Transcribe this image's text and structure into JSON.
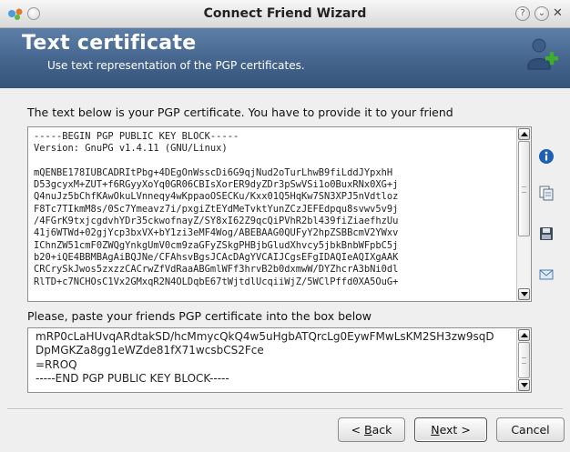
{
  "window": {
    "title": "Connect Friend Wizard"
  },
  "banner": {
    "title": "Text certificate",
    "subtitle": "Use text representation of the PGP certificates."
  },
  "main_label": "The text below is your PGP certificate. You have to provide it to your friend",
  "own_certificate": {
    "lines": [
      "-----BEGIN PGP PUBLIC KEY BLOCK-----",
      "Version: GnuPG v1.4.11 (GNU/Linux)",
      "",
      "mQENBE178IUBCADRItPbg+4DEgOnWsscDi6G9qjNud2oTurLhwB9fiLddJYpxhH",
      "D53gcyxM+ZUT+f6RGyyXoYq0GR06CBIsXorER9dyZDr3pSwVSi1o0BuxRNx0XG+j",
      "Q4nuJz5bChfKAwOkuLVnneqy4wKppaoOSECKu/Kxx01Q5HqKw7SN3XPJ5nVdtloz",
      "F8Tc7TIkmM8s/0Sc7Ymeavz7i/pxgiZtEYdMeTvktYunZCzJEFEdpqu8svwv5v9j",
      "/4FGrK9txjcgdvhYDr35ckwofnayZ/SY8xI62Z9qcQiPVhR2bl439fiZiaefhzUu",
      "41j6WTWd+02gjYcp3bxVX+bY1zi3eMF4Wog/ABEBAAG0QUFyY2hpZSBBcmV2YWxv",
      "IChnZW51cmF0ZWQgYnkgUmV0cm9zaGFyZSkgPHBjbGludXhvcy5jbkBnbWFpbC5j",
      "b20+iQE4BBMBAgAiBQJNe/CFAhsvBgsJCAcDAgYVCAIJCgsEFgIDAQIeAQIXgAAK",
      "CRCrySkJwos5zxzzCACrwZfVdRaaABGmlWFf3hrvB2b0dxmwW/DYZhcrA3bNi0dl",
      "RlTD+c7NCHOsC1Vx2GMxqR2N4OLDqbE67tWjtdlUcqiiWjZ/5WClPffd0XA5OuG+"
    ]
  },
  "paste_label": "Please, paste your friends PGP certificate into the box below",
  "friend_certificate": {
    "lines": [
      "mRP0cLaHUvqARdtakSD/hcMmycQkQ4w5uHgbATQrcLg0EywFMwLsKM2SH3zw9sqD",
      "DpMGKZa8gg1eWZde81fX71wcsbCS2Fce",
      "=RROQ",
      "-----END PGP PUBLIC KEY BLOCK-----"
    ]
  },
  "side_icons": [
    "info-icon",
    "copy-icon",
    "save-icon",
    "email-icon"
  ],
  "buttons": {
    "back_u": "B",
    "back_rest": "ack",
    "next_u": "N",
    "next_rest": "ext",
    "cancel": "Cancel"
  },
  "colors": {
    "banner_top": "#5d7fa7",
    "banner_bottom": "#35547b",
    "background": "#efefef"
  }
}
